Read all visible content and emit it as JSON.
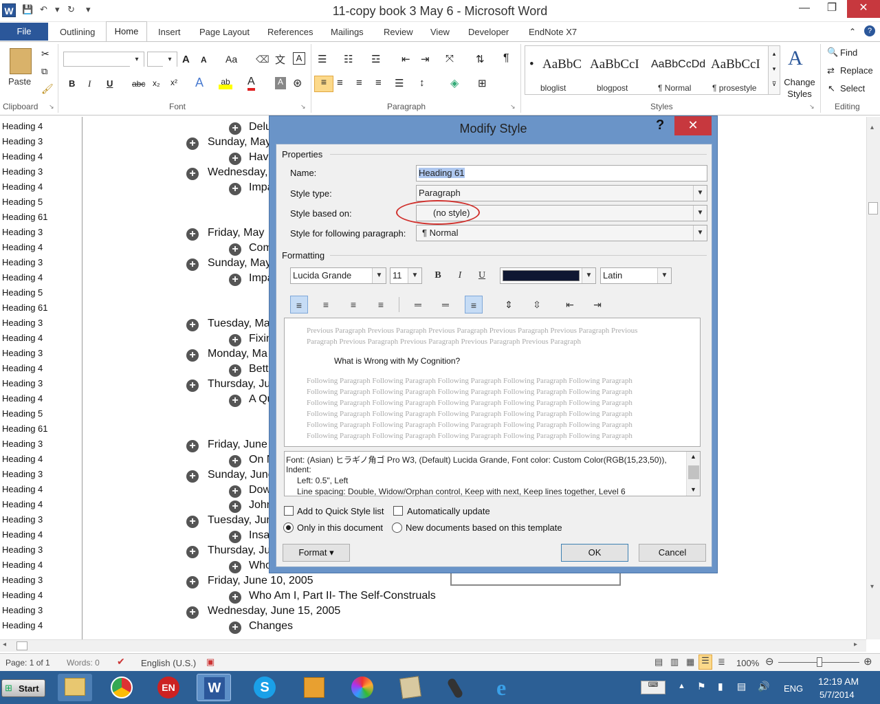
{
  "app": {
    "title": "11-copy book 3 May 6 - Microsoft Word",
    "logo_letter": "W",
    "window_controls": {
      "minimize": "—",
      "restore": "❐",
      "close": "✕"
    }
  },
  "ribbon_tabs": [
    "File",
    "Outlining",
    "Home",
    "Insert",
    "Page Layout",
    "References",
    "Mailings",
    "Review",
    "View",
    "Developer",
    "EndNote X7"
  ],
  "ribbon": {
    "clipboard": {
      "paste_label": "Paste",
      "group_label": "Clipboard"
    },
    "font": {
      "group_label": "Font",
      "bold": "B",
      "italic": "I",
      "underline": "U",
      "strike": "abc",
      "subscript": "x₂",
      "superscript": "x²",
      "grow": "A",
      "shrink": "A",
      "case": "Aa"
    },
    "paragraph": {
      "group_label": "Paragraph",
      "pilcrow": "¶"
    },
    "styles": {
      "group_label": "Styles",
      "items": [
        {
          "sample": "AaBbC",
          "name": "bloglist",
          "bullet": "•"
        },
        {
          "sample": "AaBbCcI",
          "name": "blogpost"
        },
        {
          "sample": "AaBbCcDd",
          "name": "¶ Normal"
        },
        {
          "sample": "AaBbCcI",
          "name": "¶ prosestyle"
        }
      ],
      "change_styles": "Change Styles"
    },
    "editing": {
      "group_label": "Editing",
      "find": "Find",
      "replace": "Replace",
      "select": "Select"
    }
  },
  "nav_pane": [
    "Heading 4",
    "Heading 3",
    "Heading 4",
    "Heading 3",
    "Heading 4",
    "Heading 5",
    "Heading 61",
    "Heading 3",
    "Heading 4",
    "Heading 3",
    "Heading 4",
    "Heading 5",
    "Heading 61",
    "Heading 3",
    "Heading 4",
    "Heading 3",
    "Heading 4",
    "Heading 3",
    "Heading 4",
    "Heading 5",
    "Heading 61",
    "Heading 3",
    "Heading 4",
    "Heading 3",
    "Heading 4",
    "Heading 4",
    "Heading 3",
    "Heading 4",
    "Heading 3",
    "Heading 4",
    "Heading 3",
    "Heading 4",
    "Heading 3",
    "Heading 4"
  ],
  "document_lines": [
    {
      "text": "Delu",
      "level": 2
    },
    {
      "text": "Sunday, May",
      "level": 1
    },
    {
      "text": "Have",
      "level": 2
    },
    {
      "text": "Wednesday,",
      "level": 1
    },
    {
      "text": "Impa",
      "level": 2
    },
    {
      "text": "Friday, May",
      "level": 1
    },
    {
      "text": "Com",
      "level": 2
    },
    {
      "text": "Sunday, May",
      "level": 1
    },
    {
      "text": "Impa",
      "level": 2
    },
    {
      "text": "Tuesday, Ma",
      "level": 1
    },
    {
      "text": "Fixin",
      "level": 2
    },
    {
      "text": "Monday, Ma",
      "level": 1
    },
    {
      "text": "Bett",
      "level": 2
    },
    {
      "text": "Thursday, Ju",
      "level": 1
    },
    {
      "text": "A Qu",
      "level": 2
    },
    {
      "text": "Friday, June",
      "level": 1
    },
    {
      "text": "On N",
      "level": 2
    },
    {
      "text": "Sunday, June",
      "level": 1
    },
    {
      "text": "Dow",
      "level": 2
    },
    {
      "text": "John",
      "level": 2
    },
    {
      "text": "Tuesday, Jun",
      "level": 1
    },
    {
      "text": "Insa",
      "level": 2
    },
    {
      "text": "Thursday, Ju",
      "level": 1
    },
    {
      "text": "Who",
      "level": 2
    },
    {
      "text": "Friday, June 10, 2005",
      "level": 1
    },
    {
      "text": "Who Am I, Part II- The Self-Construals",
      "level": 2
    },
    {
      "text": "Wednesday, June 15, 2005",
      "level": 1
    },
    {
      "text": "Changes",
      "level": 2
    }
  ],
  "dialog": {
    "title": "Modify Style",
    "help": "?",
    "close": "✕",
    "properties_label": "Properties",
    "name_label": "Name:",
    "name_value": "Heading 61",
    "style_type_label": "Style type:",
    "style_type_value": "Paragraph",
    "based_on_label": "Style based on:",
    "based_on_value": "(no style)",
    "following_label": "Style for following paragraph:",
    "following_value": "¶  Normal",
    "formatting_label": "Formatting",
    "font_value": "Lucida Grande",
    "size_value": "11",
    "bold": "B",
    "italic": "I",
    "underline": "U",
    "script_value": "Latin",
    "font_color": "#0f1732",
    "preview_previous": [
      "Previous Paragraph Previous Paragraph Previous Paragraph Previous Paragraph Previous Paragraph Previous",
      "Paragraph Previous Paragraph Previous Paragraph Previous Paragraph Previous Paragraph"
    ],
    "preview_sample": "What is Wrong with My Cognition?",
    "preview_following": "Following Paragraph Following Paragraph Following Paragraph Following Paragraph Following Paragraph",
    "description_lines": [
      "Font: (Asian) ヒラギノ角ゴ Pro W3, (Default) Lucida Grande, Font color: Custom Color(RGB(15,23,50)),",
      "Indent:",
      "Left:  0.5\", Left",
      "Line spacing:  Double, Widow/Orphan control, Keep with next, Keep lines together, Level 6"
    ],
    "add_quick_style": "Add to Quick Style list",
    "auto_update": "Automatically update",
    "only_this_doc": "Only in this document",
    "new_docs": "New documents based on this template",
    "format_button": "Format ▾",
    "ok": "OK",
    "cancel": "Cancel"
  },
  "status": {
    "page": "Page: 1 of 1",
    "words": "Words: 0",
    "language": "English (U.S.)",
    "zoom": "100%"
  },
  "taskbar": {
    "start": "Start",
    "lang": "ENG",
    "time": "12:19 AM",
    "date": "5/7/2014"
  },
  "colors": {
    "accent": "#2b579a",
    "dialog_frame": "#6a94c8",
    "close_red": "#c7383e",
    "taskbar": "#2c5f95",
    "annotation_circle": "#d0312d"
  }
}
